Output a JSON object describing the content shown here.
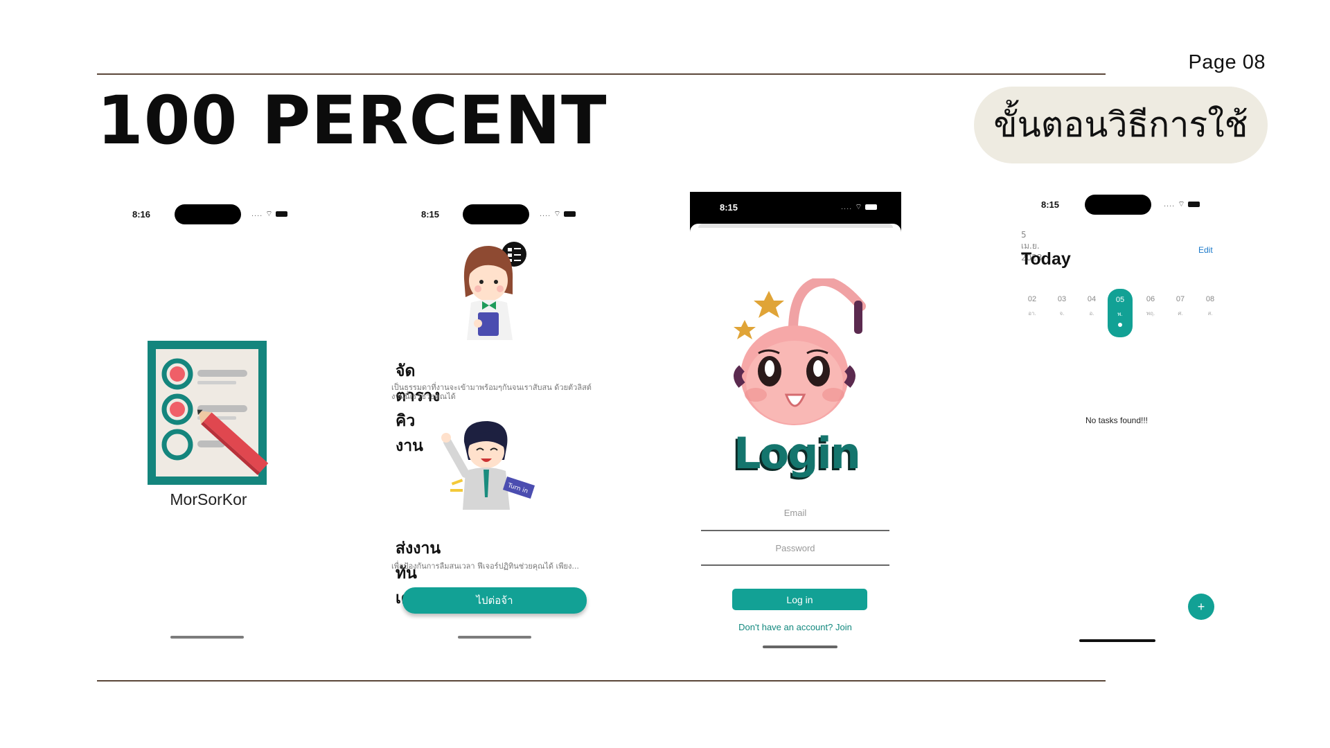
{
  "slide": {
    "page_label": "Page 08",
    "title": "100 PERCENT",
    "pill_text": "ขั้นตอนวิธีการใช้"
  },
  "phones": {
    "splash": {
      "time": "8:16",
      "app_name": "MorSorKor",
      "icon": "checklist-app-icon"
    },
    "onboarding": {
      "time": "8:15",
      "section1_title": "จัดตารางคิวงาน",
      "section1_text": "เป็นธรรมดาที่งานจะเข้ามาพร้อมๆกันจนเราสับสน ด้วยตัวลิสต์งานนี้เราช่วยคุณได้",
      "section2_title": "ส่งงานทันเดดไลน์",
      "section2_text": "เพื่อป้องกันการลืมสนเวลา ฟีเจอร์ปฏิทินช่วยคุณได้ เพียง...",
      "button_label": "ไปต่อจ้า",
      "badge_text": "Turn in"
    },
    "login": {
      "time": "8:15",
      "logo_text": "Login",
      "email_placeholder": "Email",
      "password_placeholder": "Password",
      "login_button": "Log in",
      "signup_link": "Don't have an account? Join"
    },
    "today": {
      "time": "8:15",
      "date_label": "5 เม.ย. 2023",
      "heading": "Today",
      "edit_label": "Edit",
      "days": [
        {
          "num": "02",
          "dow": "อา."
        },
        {
          "num": "03",
          "dow": "จ."
        },
        {
          "num": "04",
          "dow": "อ."
        },
        {
          "num": "05",
          "dow": "พ."
        },
        {
          "num": "06",
          "dow": "พฤ."
        },
        {
          "num": "07",
          "dow": "ศ."
        },
        {
          "num": "08",
          "dow": "ส."
        }
      ],
      "selected_day_index": 3,
      "empty_text": "No tasks found!!!",
      "fab_label": "+"
    }
  },
  "colors": {
    "accent": "#12a195",
    "line": "#5a4638",
    "pill_bg": "#eeebe1"
  }
}
